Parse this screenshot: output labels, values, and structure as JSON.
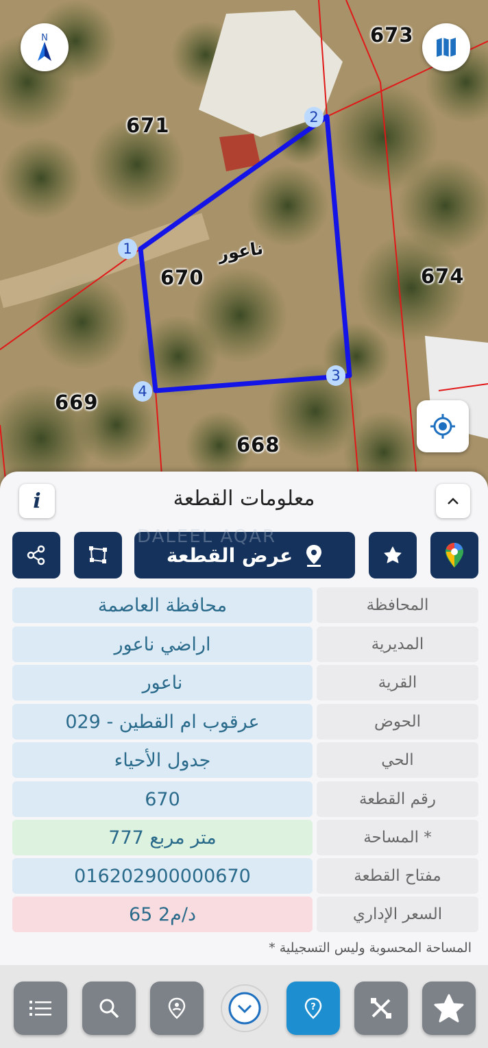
{
  "map": {
    "north_label": "N",
    "plot_numbers": [
      "673",
      "671",
      "670",
      "674",
      "669",
      "668"
    ],
    "village_label": "ناعور",
    "vertices": [
      "1",
      "2",
      "3",
      "4"
    ],
    "boundary_color": "#1414e6",
    "parcel_line_color": "#e01818"
  },
  "panel": {
    "title": "معلومات القطعة",
    "info_icon": "info-icon",
    "collapse_icon": "chevron-up-icon",
    "watermark": "DALEEL AQAR",
    "actions": {
      "show_plot_label": "عرض القطعة",
      "google_maps_icon": "google-maps-pin-icon",
      "favorite_icon": "star-icon",
      "polygon_icon": "polygon-icon",
      "share_icon": "share-icon"
    },
    "rows": [
      {
        "label": "المحافظة",
        "value": "محافظة العاصمة",
        "tint": "#dceaf6"
      },
      {
        "label": "المديرية",
        "value": "اراضي ناعور",
        "tint": "#dceaf6"
      },
      {
        "label": "القرية",
        "value": "ناعور",
        "tint": "#dceaf6"
      },
      {
        "label": "الحوض",
        "value": "عرقوب ام القطين - 029",
        "tint": "#dceaf6"
      },
      {
        "label": "الحي",
        "value": "جدول الأحياء",
        "tint": "#dceaf6"
      },
      {
        "label": "رقم القطعة",
        "value": "670",
        "tint": "#dceaf6"
      },
      {
        "label": "المساحة *",
        "value": "777  متر مربع",
        "tint": "#ddf2df"
      },
      {
        "label": "مفتاح القطعة",
        "value": "016202900000670",
        "tint": "#dceaf6"
      },
      {
        "label": "السعر الإداري",
        "value": "65 د/م2",
        "tint": "#f8dcdf"
      }
    ],
    "note": "* المساحة المحسوبة وليس التسجيلية"
  },
  "bottom_nav": [
    "list-icon",
    "search-icon",
    "location-pin-icon",
    "chevron-down-icon",
    "help-pin-icon",
    "tools-icon",
    "star-icon"
  ],
  "colors": {
    "accent_dark": "#14325c",
    "active_nav": "#1d8fd0",
    "nav_grey": "#7d8288"
  }
}
